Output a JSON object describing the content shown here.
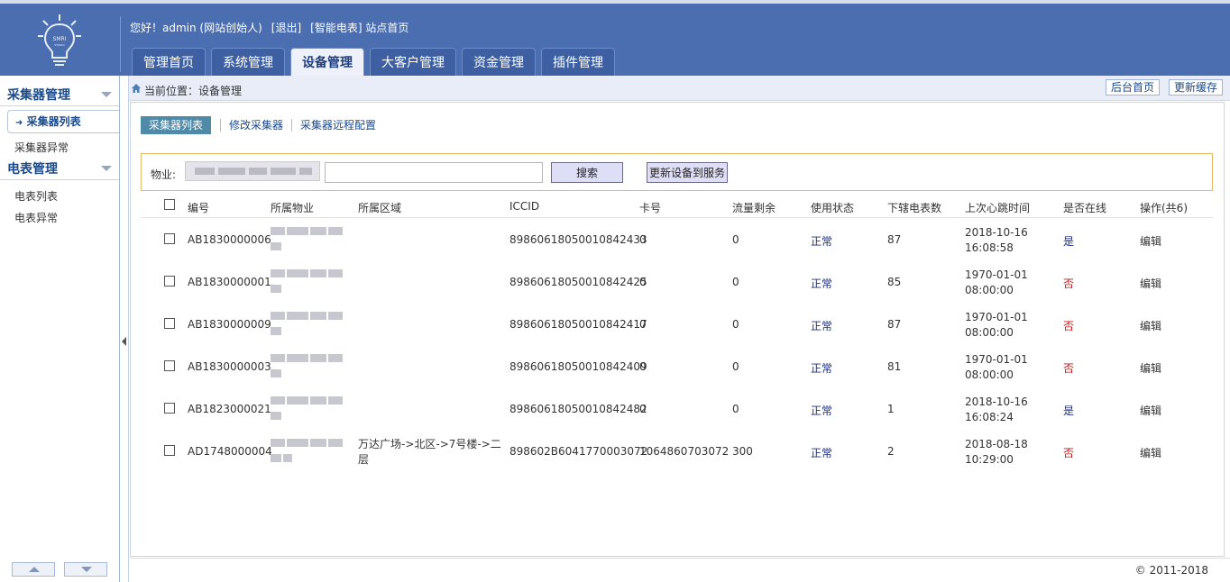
{
  "header": {
    "welcome": "您好！admin (网站创始人)",
    "logout": "[退出]",
    "site_home": "[智能电表] 站点首页",
    "tabs": [
      "管理首页",
      "系统管理",
      "设备管理",
      "大客户管理",
      "资金管理",
      "插件管理"
    ],
    "active_tab": "设备管理"
  },
  "sidebar": {
    "groups": [
      {
        "title": "采集器管理",
        "items": [
          "采集器列表",
          "采集器异常"
        ]
      },
      {
        "title": "电表管理",
        "items": [
          "电表列表",
          "电表异常"
        ]
      }
    ]
  },
  "breadcrumb": {
    "text": "当前位置：设备管理",
    "backend_home": "后台首页",
    "refresh_cache": "更新缓存"
  },
  "subtabs": [
    "采集器列表",
    "修改采集器",
    "采集器远程配置"
  ],
  "filter": {
    "label": "物业:",
    "search_value": "",
    "search_button": "搜索",
    "update_button": "更新设备到服务"
  },
  "table": {
    "headers": [
      "编号",
      "所属物业",
      "所属区域",
      "ICCID",
      "卡号",
      "流量剩余",
      "使用状态",
      "下辖电表数",
      "上次心跳时间",
      "是否在线",
      "操作(共6)"
    ],
    "rows": [
      {
        "id": "AB1830000006",
        "area": "",
        "iccid": "89860618050010842433",
        "card": "0",
        "flow": "0",
        "status": "正常",
        "meters": "87",
        "date": "2018-10-16",
        "time": "16:08:58",
        "online": "是",
        "action": "编辑"
      },
      {
        "id": "AB1830000001",
        "area": "",
        "iccid": "89860618050010842425",
        "card": "0",
        "flow": "0",
        "status": "正常",
        "meters": "85",
        "date": "1970-01-01",
        "time": "08:00:00",
        "online": "否",
        "action": "编辑"
      },
      {
        "id": "AB1830000009",
        "area": "",
        "iccid": "89860618050010842417",
        "card": "0",
        "flow": "0",
        "status": "正常",
        "meters": "87",
        "date": "1970-01-01",
        "time": "08:00:00",
        "online": "否",
        "action": "编辑"
      },
      {
        "id": "AB1830000003",
        "area": "",
        "iccid": "89860618050010842409",
        "card": "0",
        "flow": "0",
        "status": "正常",
        "meters": "81",
        "date": "1970-01-01",
        "time": "08:00:00",
        "online": "否",
        "action": "编辑"
      },
      {
        "id": "AB1823000021",
        "area": "",
        "iccid": "89860618050010842482",
        "card": "0",
        "flow": "0",
        "status": "正常",
        "meters": "1",
        "date": "2018-10-16",
        "time": "16:08:24",
        "online": "是",
        "action": "编辑"
      },
      {
        "id": "AD1748000004",
        "area": "万达广场->北区->7号楼->二层",
        "iccid": "898602B6041770003072",
        "card": "1064860703072",
        "flow": "300",
        "status": "正常",
        "meters": "2",
        "date": "2018-08-18",
        "time": "10:29:00",
        "online": "否",
        "action": "编辑"
      }
    ]
  },
  "footer": {
    "copyright": "© 2011-2018"
  },
  "colors": {
    "header": "#4a6eb0",
    "active_subtab": "#4f8aa8",
    "online_yes": "#1b2f7f",
    "online_no": "#c21919",
    "filter_border": "#e7b866"
  }
}
